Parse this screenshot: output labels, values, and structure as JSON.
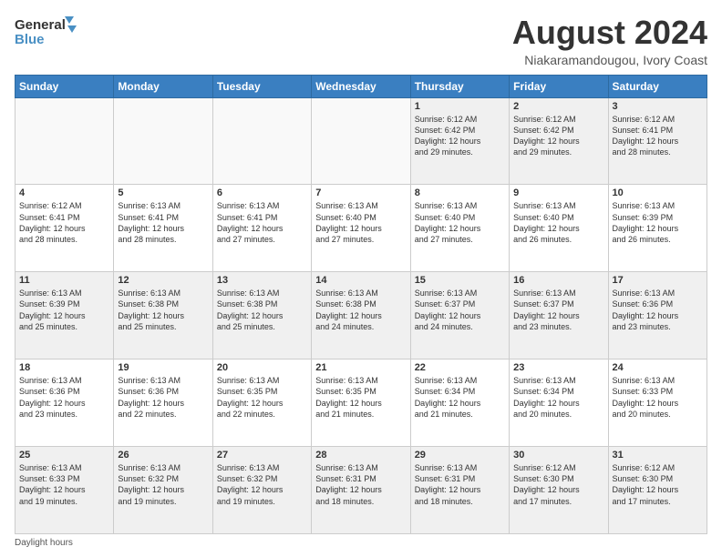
{
  "header": {
    "logo_line1": "General",
    "logo_line2": "Blue",
    "title": "August 2024",
    "subtitle": "Niakaramandougou, Ivory Coast"
  },
  "calendar": {
    "days_of_week": [
      "Sunday",
      "Monday",
      "Tuesday",
      "Wednesday",
      "Thursday",
      "Friday",
      "Saturday"
    ],
    "weeks": [
      [
        {
          "day": "",
          "info": "",
          "empty": true
        },
        {
          "day": "",
          "info": "",
          "empty": true
        },
        {
          "day": "",
          "info": "",
          "empty": true
        },
        {
          "day": "",
          "info": "",
          "empty": true
        },
        {
          "day": "1",
          "info": "Sunrise: 6:12 AM\nSunset: 6:42 PM\nDaylight: 12 hours\nand 29 minutes."
        },
        {
          "day": "2",
          "info": "Sunrise: 6:12 AM\nSunset: 6:42 PM\nDaylight: 12 hours\nand 29 minutes."
        },
        {
          "day": "3",
          "info": "Sunrise: 6:12 AM\nSunset: 6:41 PM\nDaylight: 12 hours\nand 28 minutes."
        }
      ],
      [
        {
          "day": "4",
          "info": "Sunrise: 6:12 AM\nSunset: 6:41 PM\nDaylight: 12 hours\nand 28 minutes."
        },
        {
          "day": "5",
          "info": "Sunrise: 6:13 AM\nSunset: 6:41 PM\nDaylight: 12 hours\nand 28 minutes."
        },
        {
          "day": "6",
          "info": "Sunrise: 6:13 AM\nSunset: 6:41 PM\nDaylight: 12 hours\nand 27 minutes."
        },
        {
          "day": "7",
          "info": "Sunrise: 6:13 AM\nSunset: 6:40 PM\nDaylight: 12 hours\nand 27 minutes."
        },
        {
          "day": "8",
          "info": "Sunrise: 6:13 AM\nSunset: 6:40 PM\nDaylight: 12 hours\nand 27 minutes."
        },
        {
          "day": "9",
          "info": "Sunrise: 6:13 AM\nSunset: 6:40 PM\nDaylight: 12 hours\nand 26 minutes."
        },
        {
          "day": "10",
          "info": "Sunrise: 6:13 AM\nSunset: 6:39 PM\nDaylight: 12 hours\nand 26 minutes."
        }
      ],
      [
        {
          "day": "11",
          "info": "Sunrise: 6:13 AM\nSunset: 6:39 PM\nDaylight: 12 hours\nand 25 minutes."
        },
        {
          "day": "12",
          "info": "Sunrise: 6:13 AM\nSunset: 6:38 PM\nDaylight: 12 hours\nand 25 minutes."
        },
        {
          "day": "13",
          "info": "Sunrise: 6:13 AM\nSunset: 6:38 PM\nDaylight: 12 hours\nand 25 minutes."
        },
        {
          "day": "14",
          "info": "Sunrise: 6:13 AM\nSunset: 6:38 PM\nDaylight: 12 hours\nand 24 minutes."
        },
        {
          "day": "15",
          "info": "Sunrise: 6:13 AM\nSunset: 6:37 PM\nDaylight: 12 hours\nand 24 minutes."
        },
        {
          "day": "16",
          "info": "Sunrise: 6:13 AM\nSunset: 6:37 PM\nDaylight: 12 hours\nand 23 minutes."
        },
        {
          "day": "17",
          "info": "Sunrise: 6:13 AM\nSunset: 6:36 PM\nDaylight: 12 hours\nand 23 minutes."
        }
      ],
      [
        {
          "day": "18",
          "info": "Sunrise: 6:13 AM\nSunset: 6:36 PM\nDaylight: 12 hours\nand 23 minutes."
        },
        {
          "day": "19",
          "info": "Sunrise: 6:13 AM\nSunset: 6:36 PM\nDaylight: 12 hours\nand 22 minutes."
        },
        {
          "day": "20",
          "info": "Sunrise: 6:13 AM\nSunset: 6:35 PM\nDaylight: 12 hours\nand 22 minutes."
        },
        {
          "day": "21",
          "info": "Sunrise: 6:13 AM\nSunset: 6:35 PM\nDaylight: 12 hours\nand 21 minutes."
        },
        {
          "day": "22",
          "info": "Sunrise: 6:13 AM\nSunset: 6:34 PM\nDaylight: 12 hours\nand 21 minutes."
        },
        {
          "day": "23",
          "info": "Sunrise: 6:13 AM\nSunset: 6:34 PM\nDaylight: 12 hours\nand 20 minutes."
        },
        {
          "day": "24",
          "info": "Sunrise: 6:13 AM\nSunset: 6:33 PM\nDaylight: 12 hours\nand 20 minutes."
        }
      ],
      [
        {
          "day": "25",
          "info": "Sunrise: 6:13 AM\nSunset: 6:33 PM\nDaylight: 12 hours\nand 19 minutes."
        },
        {
          "day": "26",
          "info": "Sunrise: 6:13 AM\nSunset: 6:32 PM\nDaylight: 12 hours\nand 19 minutes."
        },
        {
          "day": "27",
          "info": "Sunrise: 6:13 AM\nSunset: 6:32 PM\nDaylight: 12 hours\nand 19 minutes."
        },
        {
          "day": "28",
          "info": "Sunrise: 6:13 AM\nSunset: 6:31 PM\nDaylight: 12 hours\nand 18 minutes."
        },
        {
          "day": "29",
          "info": "Sunrise: 6:13 AM\nSunset: 6:31 PM\nDaylight: 12 hours\nand 18 minutes."
        },
        {
          "day": "30",
          "info": "Sunrise: 6:12 AM\nSunset: 6:30 PM\nDaylight: 12 hours\nand 17 minutes."
        },
        {
          "day": "31",
          "info": "Sunrise: 6:12 AM\nSunset: 6:30 PM\nDaylight: 12 hours\nand 17 minutes."
        }
      ]
    ]
  },
  "footer": {
    "note": "Daylight hours"
  }
}
